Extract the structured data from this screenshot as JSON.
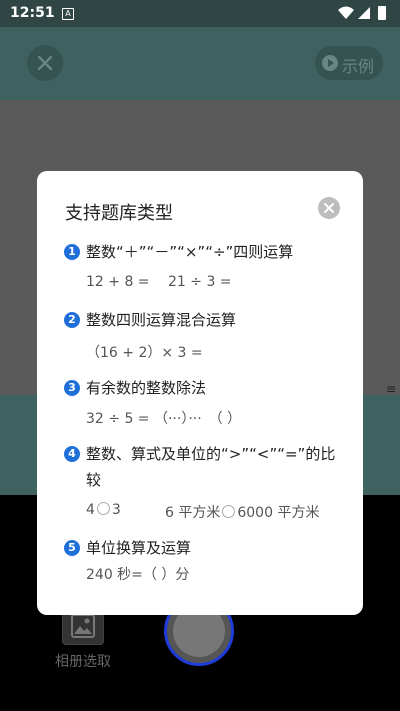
{
  "status_bar": {
    "time": "12:51",
    "app_icon_label": "A"
  },
  "camera": {
    "example_button_label": "示例",
    "album_label": "相册选取"
  },
  "dialog": {
    "title": "支持题库类型",
    "items": [
      {
        "num": "1",
        "text": "整数“＋”“－”“×”“÷”四则运算",
        "examples": [
          "12 + 8 =",
          "21 ÷ 3 ="
        ]
      },
      {
        "num": "2",
        "text": "整数四则运算混合运算",
        "examples": [
          "（16 + 2）× 3 ="
        ]
      },
      {
        "num": "3",
        "text": "有余数的整数除法",
        "examples": [
          "32 ÷ 5 = （···）···　（ ）"
        ]
      },
      {
        "num": "4",
        "text": "整数、算式及单位的“>”“<”“=”的比较",
        "examples": [
          "4",
          "3",
          "6 平方米",
          "6000 平方米"
        ]
      },
      {
        "num": "5",
        "text": "单位换算及运算",
        "examples": [
          "240 秒=（ ）分"
        ]
      }
    ]
  },
  "colors": {
    "accent": "#1f6fd9",
    "overlay_teal": "#3f6160",
    "shutter_ring": "#1f3bd9"
  }
}
